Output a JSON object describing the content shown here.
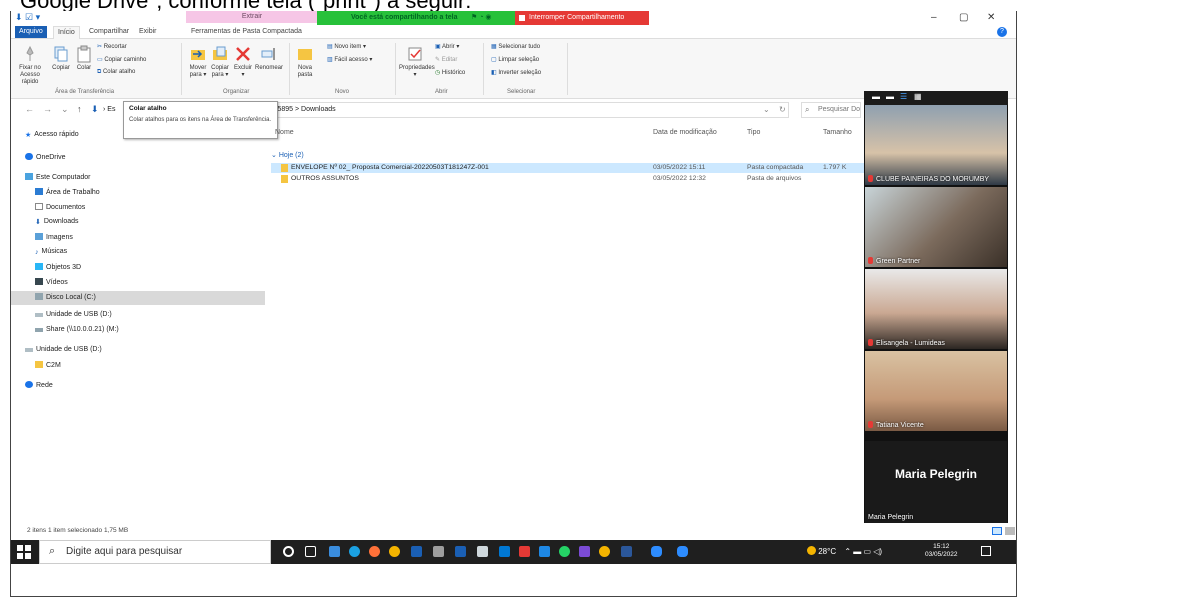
{
  "caption": "Google Drive\", conforme tela (\"print\") a seguir:",
  "titlebar": {
    "context_tab": "Extrair",
    "share_status": "Você está compartilhando a tela",
    "stop_share": "Interromper Compartilhamento",
    "minimize": "–",
    "maximize": "▢",
    "close": "✕"
  },
  "tabs": [
    "Arquivo",
    "Início",
    "Compartilhar",
    "Exibir",
    "Ferramentas de Pasta Compactada"
  ],
  "ribbon": {
    "pin": "Fixar no Acesso rápido",
    "copy": "Copiar",
    "paste": "Colar",
    "cut": "Recortar",
    "copy_path": "Copiar caminho",
    "paste_shortcut": "Colar atalho",
    "move_to": "Mover para ▾",
    "copy_to": "Copiar para ▾",
    "delete": "Excluir ▾",
    "rename": "Renomear",
    "new_folder": "Nova pasta",
    "new_item": "Novo item ▾",
    "easy_access": "Fácil acesso ▾",
    "properties": "Propriedades ▾",
    "open": "Abrir ▾",
    "edit": "Editar",
    "history": "Histórico",
    "select_all": "Selecionar tudo",
    "clear_selection": "Limpar seleção",
    "invert_selection": "Inverter seleção",
    "groups": [
      "Área de Transferência",
      "Organizar",
      "Novo",
      "Abrir",
      "Selecionar"
    ]
  },
  "address": {
    "path_start": "Es",
    "path": "s  >  5895  >  Downloads",
    "search_placeholder": "Pesquisar Dov"
  },
  "tooltip": {
    "title": "Colar atalho",
    "desc": "Colar atalhos para os itens na Área de Transferência."
  },
  "nav_items": [
    "Acesso rápido",
    "OneDrive",
    "Este Computador",
    "Área de Trabalho",
    "Documentos",
    "Downloads",
    "Imagens",
    "Músicas",
    "Objetos 3D",
    "Vídeos",
    "Disco Local (C:)",
    "Unidade de USB (D:)",
    "Share (\\\\10.0.0.21) (M:)",
    "Unidade de USB (D:)",
    "C2M",
    "Rede"
  ],
  "columns": [
    "Nome",
    "Data de modificação",
    "Tipo",
    "Tamanho"
  ],
  "group_label": "Hoje (2)",
  "files": [
    {
      "name": "ENVELOPE Nº 02_ Proposta Comercial-20220503T181247Z-001",
      "date": "03/05/2022 15:11",
      "type": "Pasta compactada",
      "size": "1.797 K"
    },
    {
      "name": "OUTROS ASSUNTOS",
      "date": "03/05/2022 12:32",
      "type": "Pasta de arquivos",
      "size": ""
    }
  ],
  "status": "2 itens    1 item selecionado  1,75 MB",
  "taskbar": {
    "search_placeholder": "Digite aqui para pesquisar",
    "temperature": "28°C",
    "time": "15:12",
    "date": "03/05/2022"
  },
  "zoom": {
    "participants": [
      "CLUBE PAINEIRAS DO MORUMBY",
      "Green Partner",
      "Elisangela - Lumideas",
      "Tatiana Vicente"
    ],
    "host_big": "Maria Pelegrin",
    "host_small": "Maria Pelegrin"
  },
  "colors": {
    "accent": "#1a5fb4",
    "share_green": "#27c13a",
    "stop_red": "#e53935",
    "selection": "#cce8ff"
  }
}
